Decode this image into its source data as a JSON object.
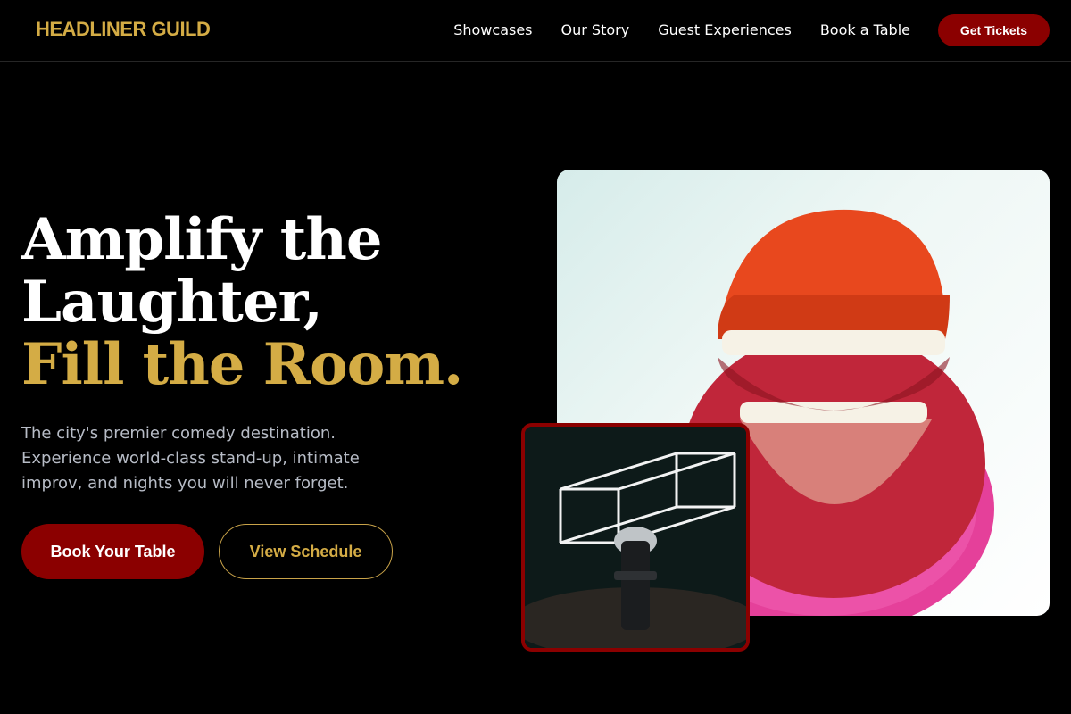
{
  "brand": "HEADLINER GUILD",
  "nav": {
    "links": [
      "Showcases",
      "Our Story",
      "Guest Experiences",
      "Book a Table"
    ],
    "cta": "Get Tickets"
  },
  "hero": {
    "title_line1": "Amplify the",
    "title_line2": "Laughter,",
    "title_line3": "Fill the Room.",
    "description": "The city's premier comedy destination. Experience world-class stand-up, intimate improv, and nights you will never forget.",
    "primary_button": "Book Your Table",
    "secondary_button": "View Schedule"
  },
  "colors": {
    "accent_gold": "#d4ac45",
    "brand_red": "#8b0000",
    "background": "#000000"
  },
  "images": {
    "main": "wind-up-chattering-teeth-on-pink-sponge",
    "inset": "microphone-under-neon-cube-light"
  }
}
